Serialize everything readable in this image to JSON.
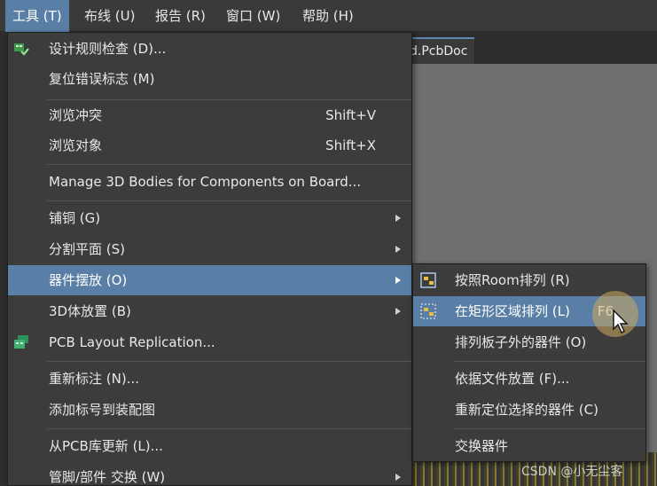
{
  "menubar": {
    "items": [
      {
        "label": "工具 (T)",
        "active": true
      },
      {
        "label": "布线 (U)",
        "active": false
      },
      {
        "label": "报告 (R)",
        "active": false
      },
      {
        "label": "窗口 (W)",
        "active": false
      },
      {
        "label": "帮助 (H)",
        "active": false
      }
    ]
  },
  "document": {
    "tab_label": "d.PcbDoc"
  },
  "tools_menu": {
    "items": [
      {
        "label": "设计规则检查 (D)...",
        "shortcut": "",
        "icon": "drc-check-icon"
      },
      {
        "label": "复位错误标志 (M)",
        "shortcut": ""
      },
      {
        "label": "浏览冲突",
        "shortcut": "Shift+V"
      },
      {
        "label": "浏览对象",
        "shortcut": "Shift+X"
      },
      {
        "label": "Manage 3D Bodies for Components on Board...",
        "shortcut": ""
      },
      {
        "label": "铺铜 (G)",
        "submenu": true
      },
      {
        "label": "分割平面 (S)",
        "submenu": true
      },
      {
        "label": "器件摆放 (O)",
        "submenu": true,
        "highlighted": true
      },
      {
        "label": "3D体放置 (B)",
        "submenu": true
      },
      {
        "label": "PCB Layout Replication...",
        "icon": "pcb-replication-icon"
      },
      {
        "label": "重新标注 (N)..."
      },
      {
        "label": "添加标号到装配图"
      },
      {
        "label": "从PCB库更新 (L)..."
      },
      {
        "label": "管脚/部件 交换 (W)",
        "submenu": true
      }
    ]
  },
  "placement_submenu": {
    "items": [
      {
        "label": "按照Room排列 (R)",
        "icon": "room-arrange-icon"
      },
      {
        "label": "在矩形区域排列 (L)",
        "shortcut": "F6",
        "icon": "rect-arrange-icon",
        "highlighted": true
      },
      {
        "label": "排列板子外的器件 (O)"
      },
      {
        "label": "依据文件放置 (F)..."
      },
      {
        "label": "重新定位选择的器件 (C)"
      },
      {
        "label": "交换器件"
      }
    ]
  },
  "watermark": "CSDN @小无尘客",
  "colors": {
    "menu_bg": "#3c3c3c",
    "highlight": "#5a7fa6",
    "canvas": "#6f6f6f"
  }
}
